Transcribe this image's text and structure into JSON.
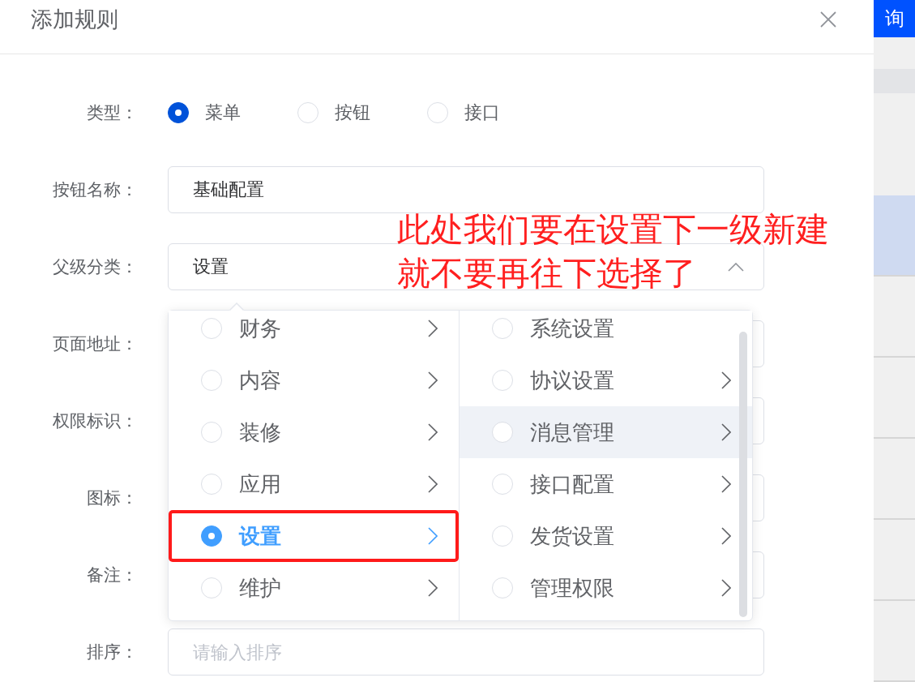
{
  "dialog": {
    "title": "添加规则"
  },
  "form": {
    "type": {
      "label": "类型：",
      "options": [
        {
          "label": "菜单",
          "selected": true
        },
        {
          "label": "按钮",
          "selected": false
        },
        {
          "label": "接口",
          "selected": false
        }
      ]
    },
    "fields": [
      {
        "label": "按钮名称：",
        "kind": "input",
        "value": "基础配置"
      },
      {
        "label": "父级分类：",
        "kind": "select",
        "value": "设置",
        "expanded": true
      },
      {
        "label": "页面地址：",
        "kind": "input"
      },
      {
        "label": "权限标识：",
        "kind": "input"
      },
      {
        "label": "图标：",
        "kind": "input"
      },
      {
        "label": "备注：",
        "kind": "input"
      },
      {
        "label": "排序：",
        "kind": "input",
        "placeholder": "请输入排序"
      }
    ]
  },
  "cascader": {
    "columns": [
      {
        "items": [
          {
            "label": "财务",
            "selected": false,
            "expandable": true,
            "hovered": false,
            "annotated": false
          },
          {
            "label": "内容",
            "selected": false,
            "expandable": true,
            "hovered": false,
            "annotated": false
          },
          {
            "label": "装修",
            "selected": false,
            "expandable": true,
            "hovered": false,
            "annotated": false
          },
          {
            "label": "应用",
            "selected": false,
            "expandable": true,
            "hovered": false,
            "annotated": false
          },
          {
            "label": "设置",
            "selected": true,
            "expandable": true,
            "hovered": false,
            "annotated": true
          },
          {
            "label": "维护",
            "selected": false,
            "expandable": true,
            "hovered": false,
            "annotated": false
          }
        ]
      },
      {
        "items": [
          {
            "label": "系统设置",
            "selected": false,
            "expandable": false,
            "hovered": false,
            "annotated": false
          },
          {
            "label": "协议设置",
            "selected": false,
            "expandable": true,
            "hovered": false,
            "annotated": false
          },
          {
            "label": "消息管理",
            "selected": false,
            "expandable": true,
            "hovered": true,
            "annotated": false
          },
          {
            "label": "接口配置",
            "selected": false,
            "expandable": true,
            "hovered": false,
            "annotated": false
          },
          {
            "label": "发货设置",
            "selected": false,
            "expandable": true,
            "hovered": false,
            "annotated": false
          },
          {
            "label": "管理权限",
            "selected": false,
            "expandable": true,
            "hovered": false,
            "annotated": false
          }
        ]
      }
    ]
  },
  "annotation": {
    "lines": [
      "此处我们要在设置下一级新建",
      "就不要再往下选择了"
    ]
  },
  "background": {
    "search_button": "询",
    "table_rows": [
      {
        "selected": true
      },
      {
        "selected": false
      },
      {
        "selected": false
      },
      {
        "selected": false
      },
      {
        "selected": false
      },
      {
        "selected": false
      }
    ]
  }
}
